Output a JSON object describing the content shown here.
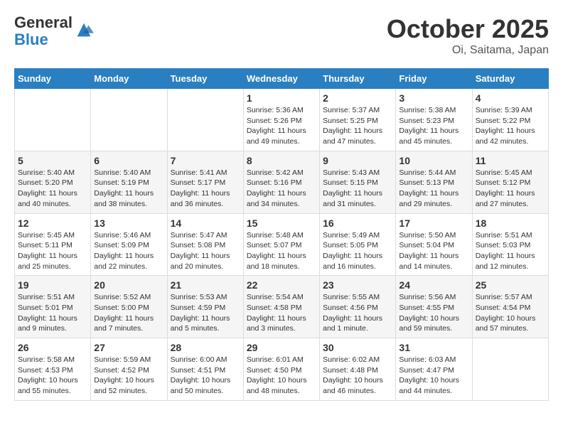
{
  "header": {
    "logo_general": "General",
    "logo_blue": "Blue",
    "month_title": "October 2025",
    "location": "Oi, Saitama, Japan"
  },
  "days_of_week": [
    "Sunday",
    "Monday",
    "Tuesday",
    "Wednesday",
    "Thursday",
    "Friday",
    "Saturday"
  ],
  "weeks": [
    [
      {
        "day": "",
        "info": ""
      },
      {
        "day": "",
        "info": ""
      },
      {
        "day": "",
        "info": ""
      },
      {
        "day": "1",
        "info": "Sunrise: 5:36 AM\nSunset: 5:26 PM\nDaylight: 11 hours and 49 minutes."
      },
      {
        "day": "2",
        "info": "Sunrise: 5:37 AM\nSunset: 5:25 PM\nDaylight: 11 hours and 47 minutes."
      },
      {
        "day": "3",
        "info": "Sunrise: 5:38 AM\nSunset: 5:23 PM\nDaylight: 11 hours and 45 minutes."
      },
      {
        "day": "4",
        "info": "Sunrise: 5:39 AM\nSunset: 5:22 PM\nDaylight: 11 hours and 42 minutes."
      }
    ],
    [
      {
        "day": "5",
        "info": "Sunrise: 5:40 AM\nSunset: 5:20 PM\nDaylight: 11 hours and 40 minutes."
      },
      {
        "day": "6",
        "info": "Sunrise: 5:40 AM\nSunset: 5:19 PM\nDaylight: 11 hours and 38 minutes."
      },
      {
        "day": "7",
        "info": "Sunrise: 5:41 AM\nSunset: 5:17 PM\nDaylight: 11 hours and 36 minutes."
      },
      {
        "day": "8",
        "info": "Sunrise: 5:42 AM\nSunset: 5:16 PM\nDaylight: 11 hours and 34 minutes."
      },
      {
        "day": "9",
        "info": "Sunrise: 5:43 AM\nSunset: 5:15 PM\nDaylight: 11 hours and 31 minutes."
      },
      {
        "day": "10",
        "info": "Sunrise: 5:44 AM\nSunset: 5:13 PM\nDaylight: 11 hours and 29 minutes."
      },
      {
        "day": "11",
        "info": "Sunrise: 5:45 AM\nSunset: 5:12 PM\nDaylight: 11 hours and 27 minutes."
      }
    ],
    [
      {
        "day": "12",
        "info": "Sunrise: 5:45 AM\nSunset: 5:11 PM\nDaylight: 11 hours and 25 minutes."
      },
      {
        "day": "13",
        "info": "Sunrise: 5:46 AM\nSunset: 5:09 PM\nDaylight: 11 hours and 22 minutes."
      },
      {
        "day": "14",
        "info": "Sunrise: 5:47 AM\nSunset: 5:08 PM\nDaylight: 11 hours and 20 minutes."
      },
      {
        "day": "15",
        "info": "Sunrise: 5:48 AM\nSunset: 5:07 PM\nDaylight: 11 hours and 18 minutes."
      },
      {
        "day": "16",
        "info": "Sunrise: 5:49 AM\nSunset: 5:05 PM\nDaylight: 11 hours and 16 minutes."
      },
      {
        "day": "17",
        "info": "Sunrise: 5:50 AM\nSunset: 5:04 PM\nDaylight: 11 hours and 14 minutes."
      },
      {
        "day": "18",
        "info": "Sunrise: 5:51 AM\nSunset: 5:03 PM\nDaylight: 11 hours and 12 minutes."
      }
    ],
    [
      {
        "day": "19",
        "info": "Sunrise: 5:51 AM\nSunset: 5:01 PM\nDaylight: 11 hours and 9 minutes."
      },
      {
        "day": "20",
        "info": "Sunrise: 5:52 AM\nSunset: 5:00 PM\nDaylight: 11 hours and 7 minutes."
      },
      {
        "day": "21",
        "info": "Sunrise: 5:53 AM\nSunset: 4:59 PM\nDaylight: 11 hours and 5 minutes."
      },
      {
        "day": "22",
        "info": "Sunrise: 5:54 AM\nSunset: 4:58 PM\nDaylight: 11 hours and 3 minutes."
      },
      {
        "day": "23",
        "info": "Sunrise: 5:55 AM\nSunset: 4:56 PM\nDaylight: 11 hours and 1 minute."
      },
      {
        "day": "24",
        "info": "Sunrise: 5:56 AM\nSunset: 4:55 PM\nDaylight: 10 hours and 59 minutes."
      },
      {
        "day": "25",
        "info": "Sunrise: 5:57 AM\nSunset: 4:54 PM\nDaylight: 10 hours and 57 minutes."
      }
    ],
    [
      {
        "day": "26",
        "info": "Sunrise: 5:58 AM\nSunset: 4:53 PM\nDaylight: 10 hours and 55 minutes."
      },
      {
        "day": "27",
        "info": "Sunrise: 5:59 AM\nSunset: 4:52 PM\nDaylight: 10 hours and 52 minutes."
      },
      {
        "day": "28",
        "info": "Sunrise: 6:00 AM\nSunset: 4:51 PM\nDaylight: 10 hours and 50 minutes."
      },
      {
        "day": "29",
        "info": "Sunrise: 6:01 AM\nSunset: 4:50 PM\nDaylight: 10 hours and 48 minutes."
      },
      {
        "day": "30",
        "info": "Sunrise: 6:02 AM\nSunset: 4:48 PM\nDaylight: 10 hours and 46 minutes."
      },
      {
        "day": "31",
        "info": "Sunrise: 6:03 AM\nSunset: 4:47 PM\nDaylight: 10 hours and 44 minutes."
      },
      {
        "day": "",
        "info": ""
      }
    ]
  ]
}
